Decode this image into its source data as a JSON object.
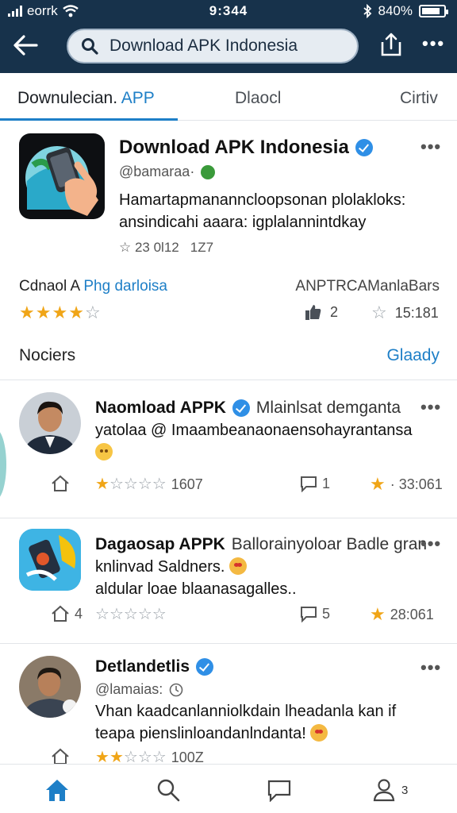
{
  "status_bar": {
    "carrier": "eorrk",
    "time": "9:344",
    "battery": "840%",
    "battery_level": 0.84
  },
  "app_bar": {
    "search_value": "Download APK Indonesia"
  },
  "tabs": [
    {
      "label": "Downulecian.",
      "accent": "APP",
      "active": true
    },
    {
      "label": "Dlaocl",
      "active": false
    },
    {
      "label": "Cirtiv",
      "active": false
    }
  ],
  "app": {
    "title": "Download APK Indonesia",
    "handle": "@bamaraa·",
    "description": "Hamartapmananncloopsonan plolakloks: ansindicahi aaara: igplalannintdkay",
    "meta_a": "☆ 23 0l12",
    "meta_b": "1Z7",
    "info_left": "Cdnaol A",
    "info_left_accent": "Phg darloisa",
    "info_right": "ANPTRCAManlaBars",
    "rating": 4,
    "likes": "2",
    "star_count": "15:181"
  },
  "section": {
    "title": "Nociers",
    "link": "Glaady"
  },
  "posts": [
    {
      "name": "Naomload APPK",
      "verified": true,
      "name_sub": "Mlainlsat demganta",
      "text": "yatolaa @ Imaambeanaonaensohayrantansa",
      "emoji": "smile",
      "likes": "",
      "rating": 1,
      "rating_text": "1607",
      "comments": "1",
      "score": "· 33:061"
    },
    {
      "name": "Dagaosap APPK",
      "verified": false,
      "name_sub": "Ballorainyoloar Badle gran",
      "text_1": "knlinvad Saldners.",
      "text_2": "aldular loae blaanasagalles..",
      "emoji": "love",
      "likes": "4",
      "rating": 0,
      "rating_text": "",
      "comments": "5",
      "score": "28:061"
    },
    {
      "name": "Detlandetlis",
      "verified": true,
      "handle": "@lamaias:",
      "text_1": "Vhan kaadcanlanniolkdain lheadanla kan if",
      "text_2": "teapa pienslinloandanlndanta!",
      "emoji": "love",
      "rating": 2,
      "rating_text": "100Z"
    }
  ],
  "bottom_nav": {
    "profile_count": "3"
  },
  "colors": {
    "app_bar": "#17324b",
    "accent": "#1e7fc7",
    "star": "#f0a517"
  }
}
